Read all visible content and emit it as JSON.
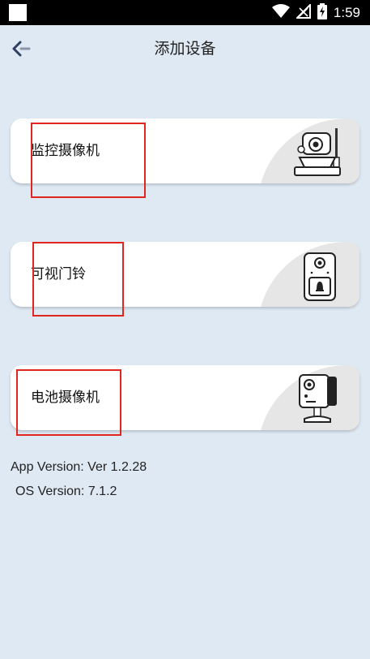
{
  "status_bar": {
    "time": "1:59"
  },
  "header": {
    "title": "添加设备"
  },
  "devices": [
    {
      "label": "监控摄像机",
      "icon": "ptz-camera"
    },
    {
      "label": "可视门铃",
      "icon": "video-doorbell"
    },
    {
      "label": "电池摄像机",
      "icon": "battery-camera"
    }
  ],
  "footer": {
    "app_version": "App Version: Ver 1.2.28",
    "os_version": "OS Version: 7.1.2"
  },
  "colors": {
    "background": "#dfe9f3",
    "highlight": "#e0261f",
    "back_arrow": "#2e3f63"
  }
}
